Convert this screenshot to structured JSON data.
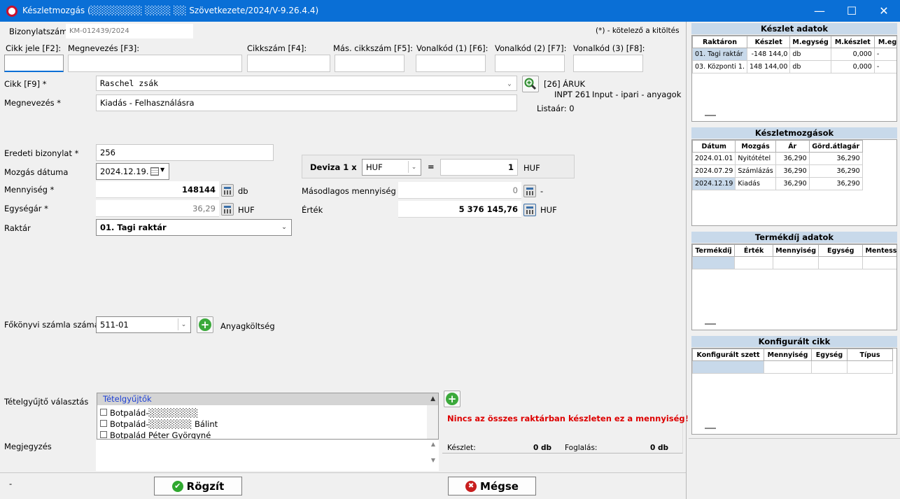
{
  "window": {
    "title": "Készletmozgás (░░░░░░░░ ░░░░ ░░ Szövetkezete/2024/V-9.26.4.4)",
    "controls": {
      "minimize": "—",
      "maximize": "☐",
      "close": "✕"
    }
  },
  "header": {
    "doc_label": "Bizonylatszám",
    "doc_value": "KM-012439/2024",
    "required_note": "(*) - kötelező a kitöltés"
  },
  "search": {
    "fields": [
      {
        "label": "Cikk jele [F2]:",
        "value": ""
      },
      {
        "label": "Megnevezés [F3]:",
        "value": ""
      },
      {
        "label": "Cikkszám [F4]:",
        "value": ""
      },
      {
        "label": "Más. cikkszám [F5]:",
        "value": ""
      },
      {
        "label": "Vonalkód (1) [F6]:",
        "value": ""
      },
      {
        "label": "Vonalkód (2) [F7]:",
        "value": ""
      },
      {
        "label": "Vonalkód (3) [F8]:",
        "value": ""
      }
    ]
  },
  "item": {
    "cikk_label": "Cikk [F9] *",
    "cikk_value": "Raschel zsák",
    "name_label": "Megnevezés *",
    "name_value": "Kiadás - Felhasználásra",
    "group_code": "[26] ÁRUK",
    "group_sub": "INPT 261",
    "group_desc": "Input - ipari - anyagok",
    "list_price": "Listaár: 0"
  },
  "form": {
    "orig_doc_label": "Eredeti bizonylat *",
    "orig_doc_value": "256",
    "date_label": "Mozgás dátuma",
    "date_value": "2024.12.19.",
    "qty_label": "Mennyiség *",
    "qty_value": "148144",
    "qty_unit": "db",
    "unit_price_label": "Egységár *",
    "unit_price_value": "36,29",
    "unit_price_unit": "HUF",
    "warehouse_label": "Raktár",
    "warehouse_value": "01. Tagi raktár",
    "currency_label": "Deviza 1 x",
    "currency_value": "HUF",
    "equals": "=",
    "rate_value": "1",
    "rate_unit": "HUF",
    "secondary_qty_label": "Másodlagos mennyiség",
    "secondary_qty_value": "0",
    "secondary_qty_unit": "-",
    "value_label": "Érték",
    "value_value": "5 376 145,76",
    "value_unit": "HUF",
    "ledger_label": "Főkönyvi számla száma",
    "ledger_value": "511-01",
    "ledger_desc": "Anyagköltség",
    "collector_label": "Tételgyűjtő választás",
    "collector_header": "Tételgyűjtők",
    "collector_items": [
      "Botpalád-░░░░░░░░",
      "Botpalád-░░░░░░░ Bálint",
      "Botpalád Péter Györgyné"
    ],
    "note_label": "Megjegyzés",
    "note_value": ""
  },
  "status": {
    "warning": "Nincs az összes raktárban készleten ez a mennyiség!",
    "stock_label": "Készlet:",
    "stock_value": "0 db",
    "reserved_label": "Foglalás:",
    "reserved_value": "0 db"
  },
  "footer": {
    "left_status": "-",
    "save_label": "Rögzít",
    "cancel_label": "Mégse"
  },
  "stock_panel": {
    "title": "Készlet adatok",
    "columns": [
      "Raktáron",
      "Készlet",
      "M.egység",
      "M.készlet",
      "M.egys"
    ],
    "rows": [
      [
        "01. Tagi raktár",
        "-148 144,0",
        "db",
        "0,000",
        "-"
      ],
      [
        "03. Központi 1.",
        "148 144,00",
        "db",
        "0,000",
        "-"
      ]
    ]
  },
  "movements_panel": {
    "title": "Készletmozgások",
    "columns": [
      "Dátum",
      "Mozgás",
      "Ár",
      "Görd.átlagár"
    ],
    "rows": [
      [
        "2024.01.01",
        "Nyitótétel",
        "36,290",
        "36,290"
      ],
      [
        "2024.07.29",
        "Számlázás",
        "36,290",
        "36,290"
      ],
      [
        "2024.12.19",
        "Kiadás",
        "36,290",
        "36,290"
      ]
    ]
  },
  "fee_panel": {
    "title": "Termékdíj adatok",
    "columns": [
      "Termékdíj",
      "Érték",
      "Mennyiség",
      "Egység",
      "Mentess"
    ]
  },
  "config_panel": {
    "title": "Konfigurált cikk",
    "columns": [
      "Konfigurált szett",
      "Mennyiség",
      "Egység",
      "Típus"
    ]
  }
}
